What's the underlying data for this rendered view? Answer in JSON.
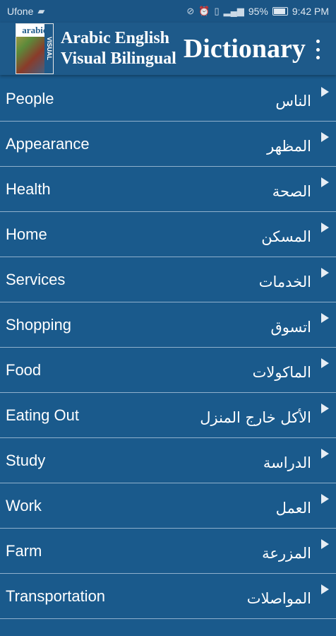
{
  "status_bar": {
    "carrier": "Ufone",
    "battery": "95%",
    "time": "9:42 PM"
  },
  "app_bar": {
    "logo_text": "arabic",
    "logo_side_text": "VISUAL",
    "title_line1": "Arabic English",
    "title_line2": "Visual Bilingual",
    "title_big": "Dictionary"
  },
  "categories": [
    {
      "en": "People",
      "ar": "الناس"
    },
    {
      "en": "Appearance",
      "ar": "المظهر"
    },
    {
      "en": "Health",
      "ar": "الصحة"
    },
    {
      "en": "Home",
      "ar": "المسكن"
    },
    {
      "en": "Services",
      "ar": "الخدمات"
    },
    {
      "en": "Shopping",
      "ar": "اتسوق"
    },
    {
      "en": "Food",
      "ar": "الماكولات"
    },
    {
      "en": "Eating Out",
      "ar": "الأكل خارج المنزل"
    },
    {
      "en": "Study",
      "ar": "الدراسة"
    },
    {
      "en": "Work",
      "ar": "العمل"
    },
    {
      "en": "Farm",
      "ar": "المزرعة"
    },
    {
      "en": "Transportation",
      "ar": "المواصلات"
    }
  ],
  "colors": {
    "background": "#1a5a8c",
    "app_bar": "#1e5a8a",
    "divider": "#8fb0cc"
  }
}
